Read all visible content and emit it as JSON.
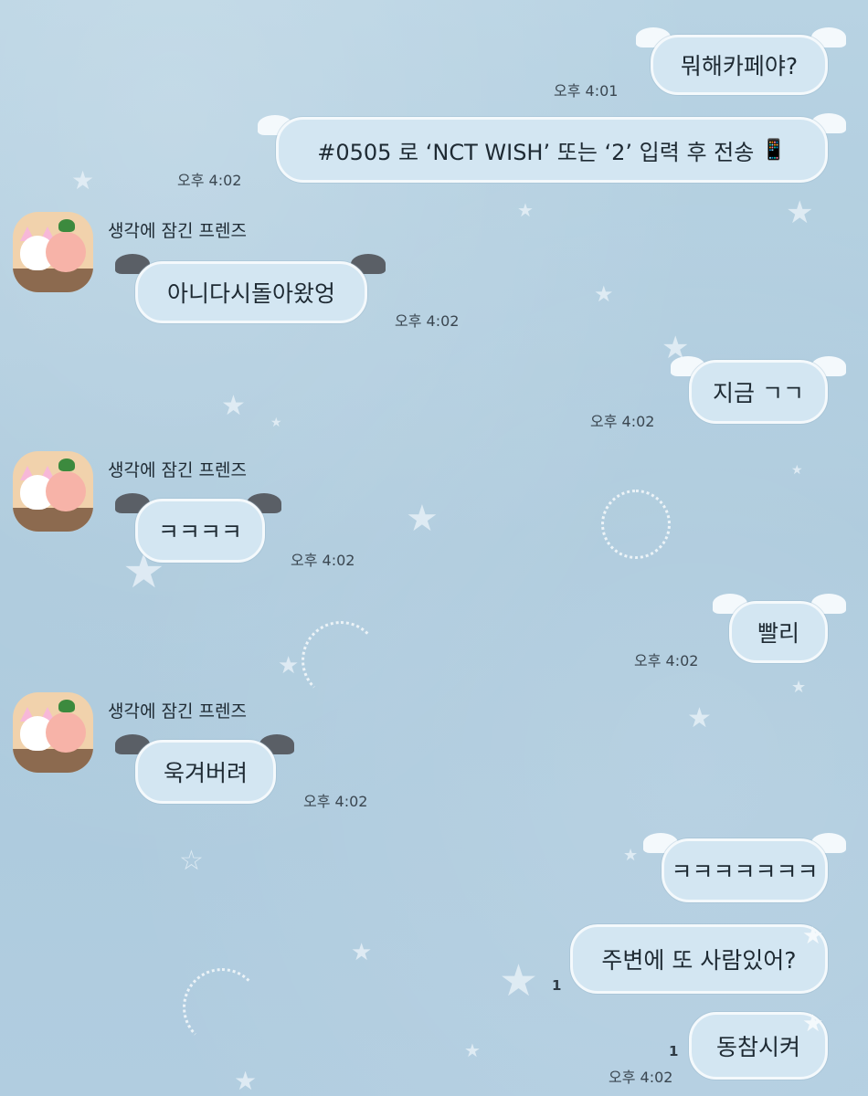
{
  "chat": {
    "sender_name": "생각에 잠긴 프렌즈",
    "messages": [
      {
        "text": "뭐해카페야?",
        "time": "오후 4:01"
      },
      {
        "text": "#0505 로 ‘NCT WISH’ 또는 ‘2’ 입력 후 전송",
        "emoji": "📱",
        "time": "오후 4:02"
      },
      {
        "text": "아니다시돌아왔엉",
        "time": "오후 4:02"
      },
      {
        "text": "지금 ㄱㄱ",
        "time": "오후 4:02"
      },
      {
        "text": "ㅋㅋㅋㅋ",
        "time": "오후 4:02"
      },
      {
        "text": "빨리",
        "time": "오후 4:02"
      },
      {
        "text": "욱겨버려",
        "time": "오후 4:02"
      },
      {
        "text": "ㅋㅋㅋㅋㅋㅋㅋ"
      },
      {
        "text": "주변에 또 사람있어?",
        "unread": "1"
      },
      {
        "text": "동참시켜",
        "unread": "1",
        "time": "오후 4:02"
      }
    ]
  },
  "colors": {
    "background": "#b3cfe0",
    "bubble": "#d3e6f2",
    "bubble_border": "#f4f9fc",
    "text": "#1e2a33"
  }
}
